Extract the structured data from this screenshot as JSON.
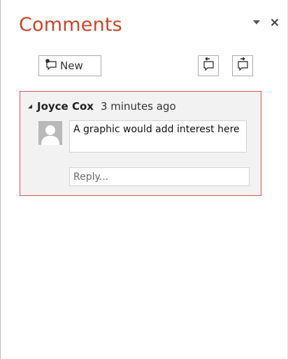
{
  "pane": {
    "title": "Comments",
    "title_color": "#c8462b",
    "controls": {
      "options_icon": "chevron-down-icon",
      "close_icon": "close-icon"
    }
  },
  "toolbar": {
    "new_label": "New",
    "new_icon": "new-comment-icon",
    "previous_icon": "previous-comment-icon",
    "next_icon": "next-comment-icon"
  },
  "comment": {
    "author": "Joyce Cox",
    "timestamp": "3 minutes ago",
    "text": "A graphic would add interest here",
    "reply_placeholder": "Reply...",
    "highlight_color": "#d9534f"
  }
}
